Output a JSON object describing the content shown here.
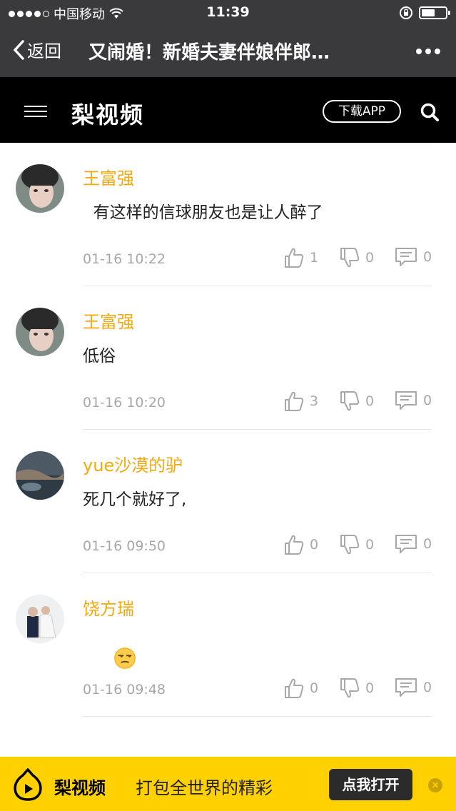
{
  "status_bar": {
    "carrier": "中国移动",
    "time": "11:39"
  },
  "nav": {
    "back_label": "返回",
    "title": "又闹婚！新婚夫妻伴娘伴郎…"
  },
  "app_header": {
    "brand": "梨视频",
    "download_label": "下载APP"
  },
  "comments": [
    {
      "user": "王富强",
      "text": "  有这样的信球朋友也是让人醉了",
      "time": "01-16 10:22",
      "likes": "1",
      "dislikes": "0",
      "replies": "0"
    },
    {
      "user": "王富强",
      "text": "低俗",
      "time": "01-16 10:20",
      "likes": "3",
      "dislikes": "0",
      "replies": "0"
    },
    {
      "user": "yue沙漠的驴",
      "text": "死几个就好了,",
      "time": "01-16 09:50",
      "likes": "0",
      "dislikes": "0",
      "replies": "0"
    },
    {
      "user": "饶方瑞",
      "text": "",
      "time": "01-16 09:48",
      "likes": "0",
      "dislikes": "0",
      "replies": "0",
      "emoji": "unamused-face-emoji"
    }
  ],
  "banner": {
    "brand": "梨视频",
    "slogan": "打包全世界的精彩",
    "open_label": "点我打开"
  },
  "colors": {
    "username": "#f3a90e",
    "banner_bg": "#ffd100",
    "header_bg": "#000000",
    "nav_bg": "#3a3a3c"
  }
}
